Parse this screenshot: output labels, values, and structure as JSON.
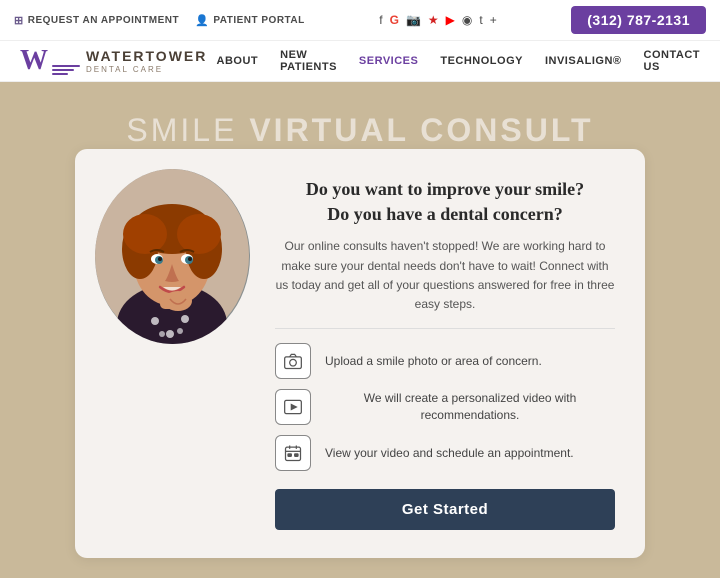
{
  "topbar": {
    "appointment_label": "REQUEST AN APPOINTMENT",
    "portal_label": "PATIENT PORTAL",
    "phone": "(312) 787-2131",
    "social_icons": [
      "f",
      "G",
      "i",
      "yelp",
      "▶",
      "rss",
      "t",
      "plus"
    ]
  },
  "logo": {
    "name": "WATERTOWER",
    "sub": "DENTAL CARE"
  },
  "nav": {
    "items": [
      {
        "label": "ABOUT"
      },
      {
        "label": "NEW PATIENTS"
      },
      {
        "label": "SERVICES"
      },
      {
        "label": "TECHNOLOGY"
      },
      {
        "label": "INVISALIGN®"
      },
      {
        "label": "CONTACT US"
      }
    ]
  },
  "hero": {
    "title_normal": "SMILE ",
    "title_bold": "VIRTUAL CONSULT"
  },
  "card": {
    "heading_line1": "Do you want to improve your smile?",
    "heading_line2": "Do you have a dental concern?",
    "description": "Our online consults haven't stopped! We are working hard to make sure your dental needs don't have to wait! Connect with us today and get all of your questions answered for free in three easy steps.",
    "steps": [
      {
        "text": "Upload a smile photo or area of concern.",
        "icon": "camera"
      },
      {
        "text": "We will create a personalized video with recommendations.",
        "icon": "play"
      },
      {
        "text": "View your video and schedule an appointment.",
        "icon": "calendar"
      }
    ],
    "cta_label": "Get Started"
  }
}
